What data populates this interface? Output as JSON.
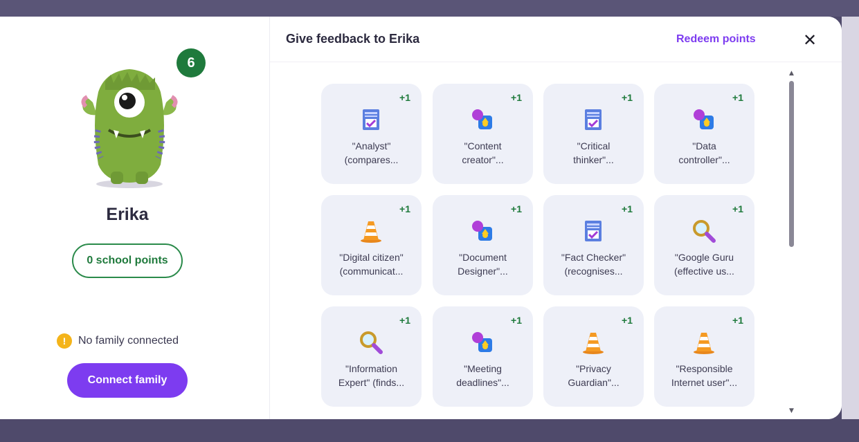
{
  "student": {
    "name": "Erika",
    "badge_count": "6",
    "points_label": "0 school points",
    "family_status": "No family connected",
    "connect_button": "Connect family"
  },
  "header": {
    "title": "Give feedback to Erika",
    "redeem_label": "Redeem points",
    "close_label": "✕"
  },
  "skills": [
    {
      "label": "\"Analyst\"\n(compares...",
      "points": "+1",
      "icon": "checklist-icon"
    },
    {
      "label": "\"Content\ncreator\"...",
      "points": "+1",
      "icon": "shapes-icon"
    },
    {
      "label": "\"Critical\nthinker\"...",
      "points": "+1",
      "icon": "checklist-icon"
    },
    {
      "label": "\"Data\ncontroller\"...",
      "points": "+1",
      "icon": "shapes-icon"
    },
    {
      "label": "\"Digital citizen\"\n(communicat...",
      "points": "+1",
      "icon": "traffic-cone-icon"
    },
    {
      "label": "\"Document\nDesigner\"...",
      "points": "+1",
      "icon": "shapes-icon"
    },
    {
      "label": "\"Fact Checker\"\n(recognises...",
      "points": "+1",
      "icon": "checklist-icon"
    },
    {
      "label": "\"Google Guru\n(effective us...",
      "points": "+1",
      "icon": "magnifier-icon"
    },
    {
      "label": "\"Information\nExpert\" (finds...",
      "points": "+1",
      "icon": "magnifier-icon"
    },
    {
      "label": "\"Meeting\ndeadlines\"...",
      "points": "+1",
      "icon": "shapes-icon"
    },
    {
      "label": "\"Privacy\nGuardian\"...",
      "points": "+1",
      "icon": "traffic-cone-icon"
    },
    {
      "label": "\"Responsible\nInternet user\"...",
      "points": "+1",
      "icon": "traffic-cone-icon"
    }
  ],
  "colors": {
    "accent": "#7d3cf0",
    "points_green": "#1f7a3c",
    "tile_bg": "#eef0f8"
  }
}
